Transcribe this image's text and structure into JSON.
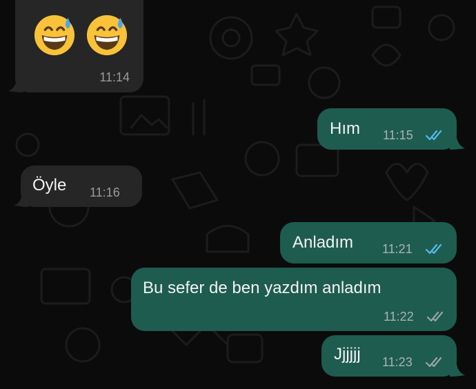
{
  "chat": {
    "messages": [
      {
        "direction": "incoming",
        "content": [
          "grinning-face-with-sweat",
          "grinning-face-with-sweat"
        ],
        "time": "11:14"
      },
      {
        "direction": "outgoing",
        "text": "Hım",
        "time": "11:15",
        "status": "read"
      },
      {
        "direction": "incoming",
        "text": "Öyle",
        "time": "11:16"
      },
      {
        "direction": "outgoing",
        "text": "Anladım",
        "time": "11:21",
        "status": "read"
      },
      {
        "direction": "outgoing",
        "text": "Bu sefer de ben yazdım anladım",
        "time": "11:22",
        "status": "delivered"
      },
      {
        "direction": "outgoing",
        "text": "Jjjjjj",
        "time": "11:23",
        "status": "delivered"
      }
    ]
  },
  "colors": {
    "background": "#0b0b0b",
    "incoming_bubble": "#262626",
    "outgoing_bubble": "#1e5c4f",
    "read_ticks": "#53bdeb",
    "delivered_ticks": "#9aa6a2"
  }
}
